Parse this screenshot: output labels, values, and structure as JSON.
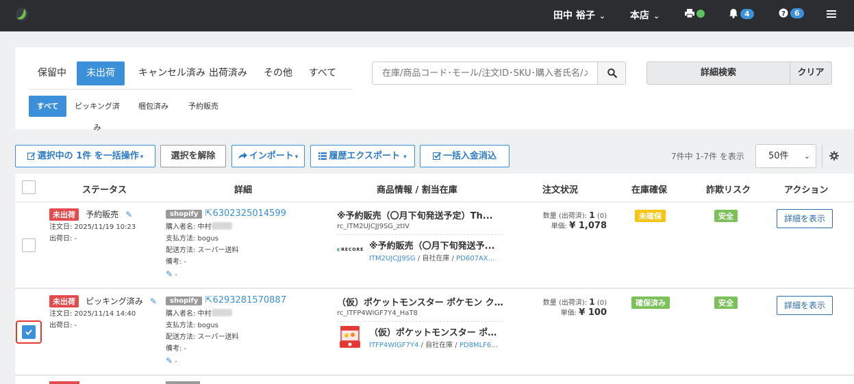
{
  "header": {
    "user": "田中 裕子",
    "store": "本店",
    "notifications_count": "4",
    "help_count": "6"
  },
  "filters": {
    "tabs": [
      "保留中",
      "未出荷",
      "キャンセル済み",
      "出荷済み",
      "その他",
      "すべて"
    ],
    "active_tab": "未出荷",
    "subtabs": [
      "すべて",
      "ピッキング済み",
      "梱包済み",
      "予約販売"
    ],
    "active_subtab": "すべて",
    "search_placeholder": "在庫/商品コード･モール/注文ID･SKU･購入者氏名/メール",
    "advanced_search": "詳細検索",
    "clear": "クリア"
  },
  "toolbar": {
    "bulk_action": "選択中の 1件 を一括操作",
    "deselect": "選択を解除",
    "import": "インポート",
    "export": "履歴エクスポート",
    "bulk_payment": "一括入金消込",
    "count_text": "7件中 1-7件 を表示",
    "per_page": "50件"
  },
  "table": {
    "headers": {
      "status": "ステータス",
      "detail": "詳細",
      "product": "商品情報 / 割当在庫",
      "order_status": "注文状況",
      "stock": "在庫確保",
      "fraud": "詐欺リスク",
      "action": "アクション"
    },
    "rows": [
      {
        "status_label": "未出荷",
        "status_sub": "予約販売",
        "order_date": "注文日: 2025/11/19 10:23",
        "ship_date": "出荷日: -",
        "mall": "shopify",
        "order_id": "6302325014599",
        "buyer": "購入者名: 中村",
        "payment": "支払方法: bogus",
        "delivery": "配送方法: スーパー送料",
        "note": "備考: -",
        "memo": "-",
        "product_title": "※予約販売（〇月下旬発送予定）Th...",
        "product_sku": "rc_ITM2UJCJJ9SG_ztIV",
        "brand": "RECORE",
        "sub_title": "※予約販売（〇月下旬発送予...",
        "sub_code": "ITM2UJCJJ9SG",
        "sub_stock": "自社在庫",
        "sub_loc": "PD607AX...",
        "qty": "数量 (出荷済): ",
        "qty_num": "1",
        "qty_ship": " (0)",
        "price_label": "単価: ",
        "price": "¥ 1,078",
        "stock_status": "未確保",
        "fraud": "安全",
        "action": "詳細を表示",
        "checked": false
      },
      {
        "status_label": "未出荷",
        "status_sub": "ピッキング済み",
        "order_date": "注文日: 2025/11/14 14:40",
        "ship_date": "出荷日: -",
        "mall": "shopify",
        "order_id": "6293281570887",
        "buyer": "購入者名: 中村",
        "payment": "支払方法: bogus",
        "delivery": "配送方法: スーパー送料",
        "note": "備考: -",
        "memo": "-",
        "product_title": "（仮）ポケットモンスター ポケモン クレーン...",
        "product_sku": "rc_ITFP4WIGF7Y4_HaT8",
        "sub_title": "（仮）ポケットモンスター ポケモン...",
        "sub_code": "ITFP4WIGF7Y4",
        "sub_stock": "自社在庫",
        "sub_loc": "PD8MLF6...",
        "qty": "数量 (出荷済): ",
        "qty_num": "1",
        "qty_ship": " (0)",
        "price_label": "単価: ",
        "price": "¥ 100",
        "stock_status": "確保済み",
        "fraud": "安全",
        "action": "詳細を表示",
        "checked": true
      }
    ]
  }
}
